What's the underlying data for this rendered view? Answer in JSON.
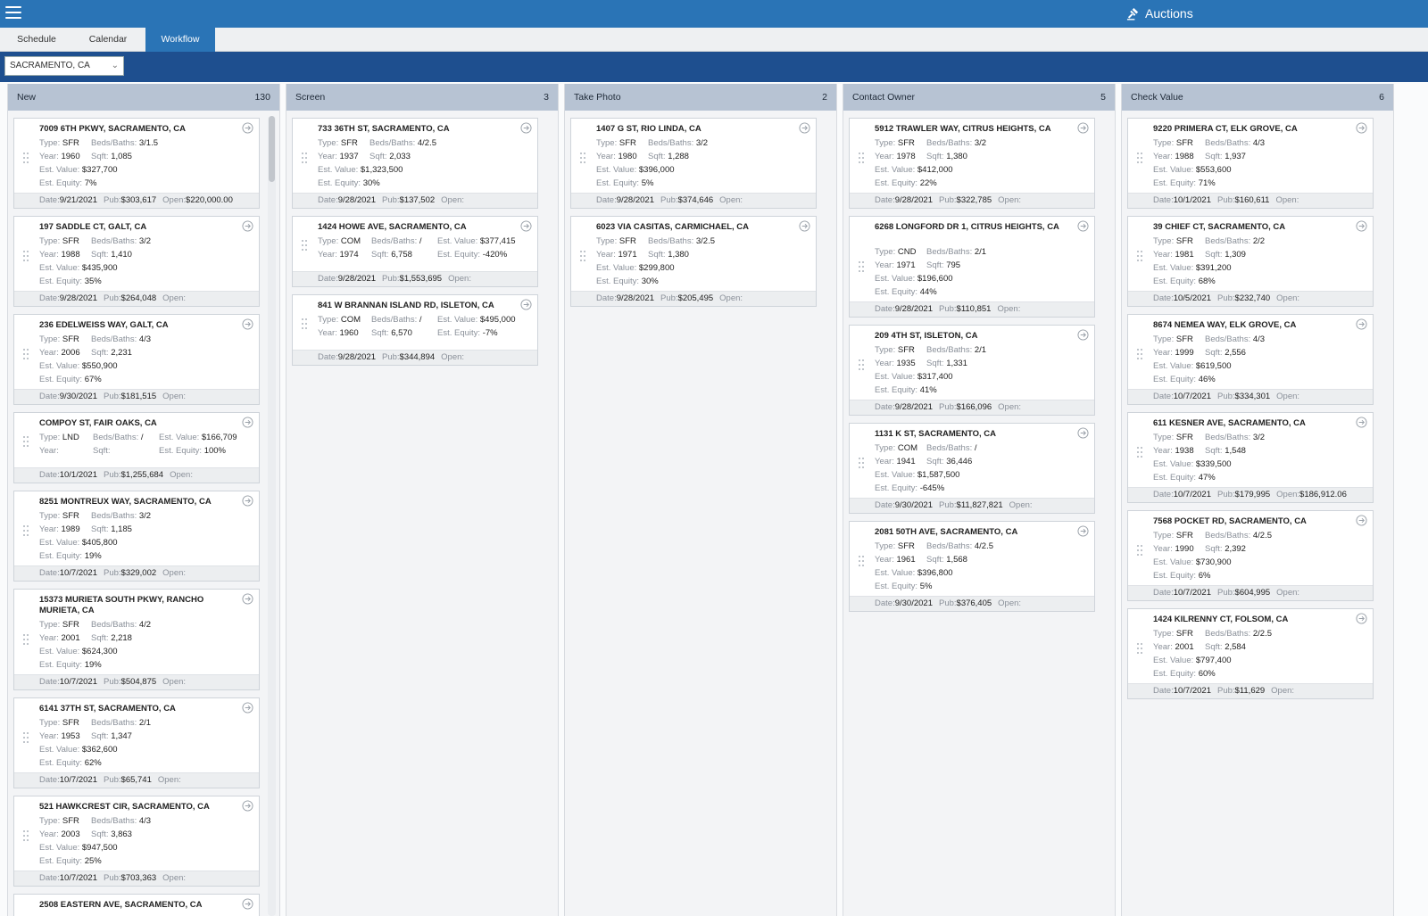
{
  "app": {
    "title": "Auctions"
  },
  "tabs": [
    {
      "label": "Schedule"
    },
    {
      "label": "Calendar"
    },
    {
      "label": "Workflow",
      "active": true
    }
  ],
  "filter": {
    "location": "SACRAMENTO, CA"
  },
  "labels": {
    "type": "Type:",
    "beds": "Beds/Baths:",
    "year": "Year:",
    "sqft": "Sqft:",
    "est_value": "Est. Value:",
    "est_equity": "Est. Equity:",
    "date": "Date:",
    "pub": "Pub:",
    "open": "Open:"
  },
  "columns": [
    {
      "name": "New",
      "count": "130",
      "cards": [
        {
          "address": "7009 6TH PKWY, SACRAMENTO, CA",
          "type": "SFR",
          "beds": "3/1.5",
          "year": "1960",
          "sqft": "1,085",
          "value": "$327,700",
          "equity": "7%",
          "date": "9/21/2021",
          "pub": "$303,617",
          "open": "$220,000.00"
        },
        {
          "address": "197 SADDLE CT, GALT, CA",
          "type": "SFR",
          "beds": "3/2",
          "year": "1988",
          "sqft": "1,410",
          "value": "$435,900",
          "equity": "35%",
          "date": "9/28/2021",
          "pub": "$264,048",
          "open": ""
        },
        {
          "address": "236 EDELWEISS WAY, GALT, CA",
          "type": "SFR",
          "beds": "4/3",
          "year": "2006",
          "sqft": "2,231",
          "value": "$550,900",
          "equity": "67%",
          "date": "9/30/2021",
          "pub": "$181,515",
          "open": ""
        },
        {
          "address": "COMPOY ST, FAIR OAKS, CA",
          "type": "LND",
          "beds": "/",
          "year": "",
          "sqft": "",
          "value": "$166,709",
          "equity": "100%",
          "date": "10/1/2021",
          "pub": "$1,255,684",
          "open": "",
          "compact": true
        },
        {
          "address": "8251 MONTREUX WAY, SACRAMENTO, CA",
          "type": "SFR",
          "beds": "3/2",
          "year": "1989",
          "sqft": "1,185",
          "value": "$405,800",
          "equity": "19%",
          "date": "10/7/2021",
          "pub": "$329,002",
          "open": ""
        },
        {
          "address": "15373 MURIETA SOUTH PKWY, RANCHO MURIETA, CA",
          "type": "SFR",
          "beds": "4/2",
          "year": "2001",
          "sqft": "2,218",
          "value": "$624,300",
          "equity": "19%",
          "date": "10/7/2021",
          "pub": "$504,875",
          "open": ""
        },
        {
          "address": "6141 37TH ST, SACRAMENTO, CA",
          "type": "SFR",
          "beds": "2/1",
          "year": "1953",
          "sqft": "1,347",
          "value": "$362,600",
          "equity": "62%",
          "date": "10/7/2021",
          "pub": "$65,741",
          "open": ""
        },
        {
          "address": "521 HAWKCREST CIR, SACRAMENTO, CA",
          "type": "SFR",
          "beds": "4/3",
          "year": "2003",
          "sqft": "3,863",
          "value": "$947,500",
          "equity": "25%",
          "date": "10/7/2021",
          "pub": "$703,363",
          "open": ""
        },
        {
          "address": "2508 EASTERN AVE, SACRAMENTO, CA",
          "type": "",
          "beds": "",
          "year": "",
          "sqft": "",
          "value": "",
          "equity": "",
          "date": "",
          "pub": "",
          "open": ""
        }
      ]
    },
    {
      "name": "Screen",
      "count": "3",
      "cards": [
        {
          "address": "733 36TH ST, SACRAMENTO, CA",
          "type": "SFR",
          "beds": "4/2.5",
          "year": "1937",
          "sqft": "2,033",
          "value": "$1,323,500",
          "equity": "30%",
          "date": "9/28/2021",
          "pub": "$137,502",
          "open": ""
        },
        {
          "address": "1424 HOWE AVE, SACRAMENTO, CA",
          "type": "COM",
          "beds": "/",
          "year": "1974",
          "sqft": "6,758",
          "value": "$377,415",
          "equity": "-420%",
          "date": "9/28/2021",
          "pub": "$1,553,695",
          "open": "",
          "compact": true
        },
        {
          "address": "841 W BRANNAN ISLAND RD, ISLETON, CA",
          "type": "COM",
          "beds": "/",
          "year": "1960",
          "sqft": "6,570",
          "value": "$495,000",
          "equity": "-7%",
          "date": "9/28/2021",
          "pub": "$344,894",
          "open": "",
          "compact": true
        }
      ]
    },
    {
      "name": "Take Photo",
      "count": "2",
      "cards": [
        {
          "address": "1407 G ST, RIO LINDA, CA",
          "type": "SFR",
          "beds": "3/2",
          "year": "1980",
          "sqft": "1,288",
          "value": "$396,000",
          "equity": "5%",
          "date": "9/28/2021",
          "pub": "$374,646",
          "open": ""
        },
        {
          "address": "6023 VIA CASITAS, CARMICHAEL, CA",
          "type": "SFR",
          "beds": "3/2.5",
          "year": "1971",
          "sqft": "1,380",
          "value": "$299,800",
          "equity": "30%",
          "date": "9/28/2021",
          "pub": "$205,495",
          "open": ""
        }
      ]
    },
    {
      "name": "Contact Owner",
      "count": "5",
      "cards": [
        {
          "address": "5912 TRAWLER WAY, CITRUS HEIGHTS, CA",
          "type": "SFR",
          "beds": "3/2",
          "year": "1978",
          "sqft": "1,380",
          "value": "$412,000",
          "equity": "22%",
          "date": "9/28/2021",
          "pub": "$322,785",
          "open": ""
        },
        {
          "address": "6268 LONGFORD DR 1, CITRUS HEIGHTS, CA",
          "type": "CND",
          "beds": "2/1",
          "year": "1971",
          "sqft": "795",
          "value": "$196,600",
          "equity": "44%",
          "date": "9/28/2021",
          "pub": "$110,851",
          "open": ""
        },
        {
          "address": "209 4TH ST, ISLETON, CA",
          "type": "SFR",
          "beds": "2/1",
          "year": "1935",
          "sqft": "1,331",
          "value": "$317,400",
          "equity": "41%",
          "date": "9/28/2021",
          "pub": "$166,096",
          "open": ""
        },
        {
          "address": "1131 K ST, SACRAMENTO, CA",
          "type": "COM",
          "beds": "/",
          "year": "1941",
          "sqft": "36,446",
          "value": "$1,587,500",
          "equity": "-645%",
          "date": "9/30/2021",
          "pub": "$11,827,821",
          "open": ""
        },
        {
          "address": "2081 50TH AVE, SACRAMENTO, CA",
          "type": "SFR",
          "beds": "4/2.5",
          "year": "1961",
          "sqft": "1,568",
          "value": "$396,800",
          "equity": "5%",
          "date": "9/30/2021",
          "pub": "$376,405",
          "open": ""
        }
      ]
    },
    {
      "name": "Check Value",
      "count": "6",
      "cards": [
        {
          "address": "9220 PRIMERA CT, ELK GROVE, CA",
          "type": "SFR",
          "beds": "4/3",
          "year": "1988",
          "sqft": "1,937",
          "value": "$553,600",
          "equity": "71%",
          "date": "10/1/2021",
          "pub": "$160,611",
          "open": ""
        },
        {
          "address": "39 CHIEF CT, SACRAMENTO, CA",
          "type": "SFR",
          "beds": "2/2",
          "year": "1981",
          "sqft": "1,309",
          "value": "$391,200",
          "equity": "68%",
          "date": "10/5/2021",
          "pub": "$232,740",
          "open": ""
        },
        {
          "address": "8674 NEMEA WAY, ELK GROVE, CA",
          "type": "SFR",
          "beds": "4/3",
          "year": "1999",
          "sqft": "2,556",
          "value": "$619,500",
          "equity": "46%",
          "date": "10/7/2021",
          "pub": "$334,301",
          "open": ""
        },
        {
          "address": "611 KESNER AVE, SACRAMENTO, CA",
          "type": "SFR",
          "beds": "3/2",
          "year": "1938",
          "sqft": "1,548",
          "value": "$339,500",
          "equity": "47%",
          "date": "10/7/2021",
          "pub": "$179,995",
          "open": "$186,912.06"
        },
        {
          "address": "7568 POCKET RD, SACRAMENTO, CA",
          "type": "SFR",
          "beds": "4/2.5",
          "year": "1990",
          "sqft": "2,392",
          "value": "$730,900",
          "equity": "6%",
          "date": "10/7/2021",
          "pub": "$604,995",
          "open": ""
        },
        {
          "address": "1424 KILRENNY CT, FOLSOM, CA",
          "type": "SFR",
          "beds": "2/2.5",
          "year": "2001",
          "sqft": "2,584",
          "value": "$797,400",
          "equity": "60%",
          "date": "10/7/2021",
          "pub": "$11,629",
          "open": ""
        }
      ]
    }
  ]
}
